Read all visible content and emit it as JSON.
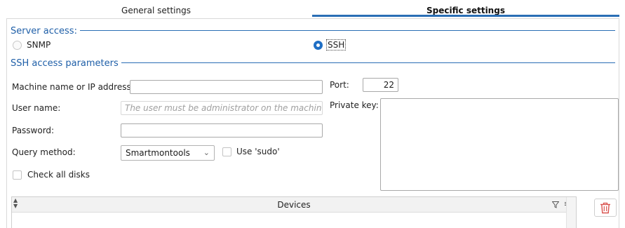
{
  "tabs": {
    "general": "General settings",
    "specific": "Specific settings"
  },
  "server_access": {
    "title": "Server access:",
    "options": [
      "SNMP",
      "SSH"
    ],
    "selected": "SSH"
  },
  "ssh": {
    "title": "SSH access parameters",
    "machine_label": "Machine name or IP address:",
    "machine_value": "",
    "user_label": "User name:",
    "user_placeholder": "The user must be administrator on the machine to be q",
    "password_label": "Password:",
    "password_value": "",
    "query_label": "Query method:",
    "query_value": "Smartmontools",
    "sudo_label": "Use 'sudo'",
    "sudo_checked": false,
    "check_disks_label": "Check all disks",
    "check_disks_checked": false,
    "port_label": "Port:",
    "port_value": "22",
    "private_key_label": "Private key:",
    "private_key_value": ""
  },
  "devices": {
    "header": "Devices"
  },
  "colors": {
    "accent": "#2a6eb5",
    "group_title": "#1f5fa8",
    "delete_icon": "#d9534f"
  },
  "icons": [
    "sort-icon",
    "filter-icon",
    "column-menu-icon",
    "trash-icon",
    "chevron-down-icon"
  ]
}
